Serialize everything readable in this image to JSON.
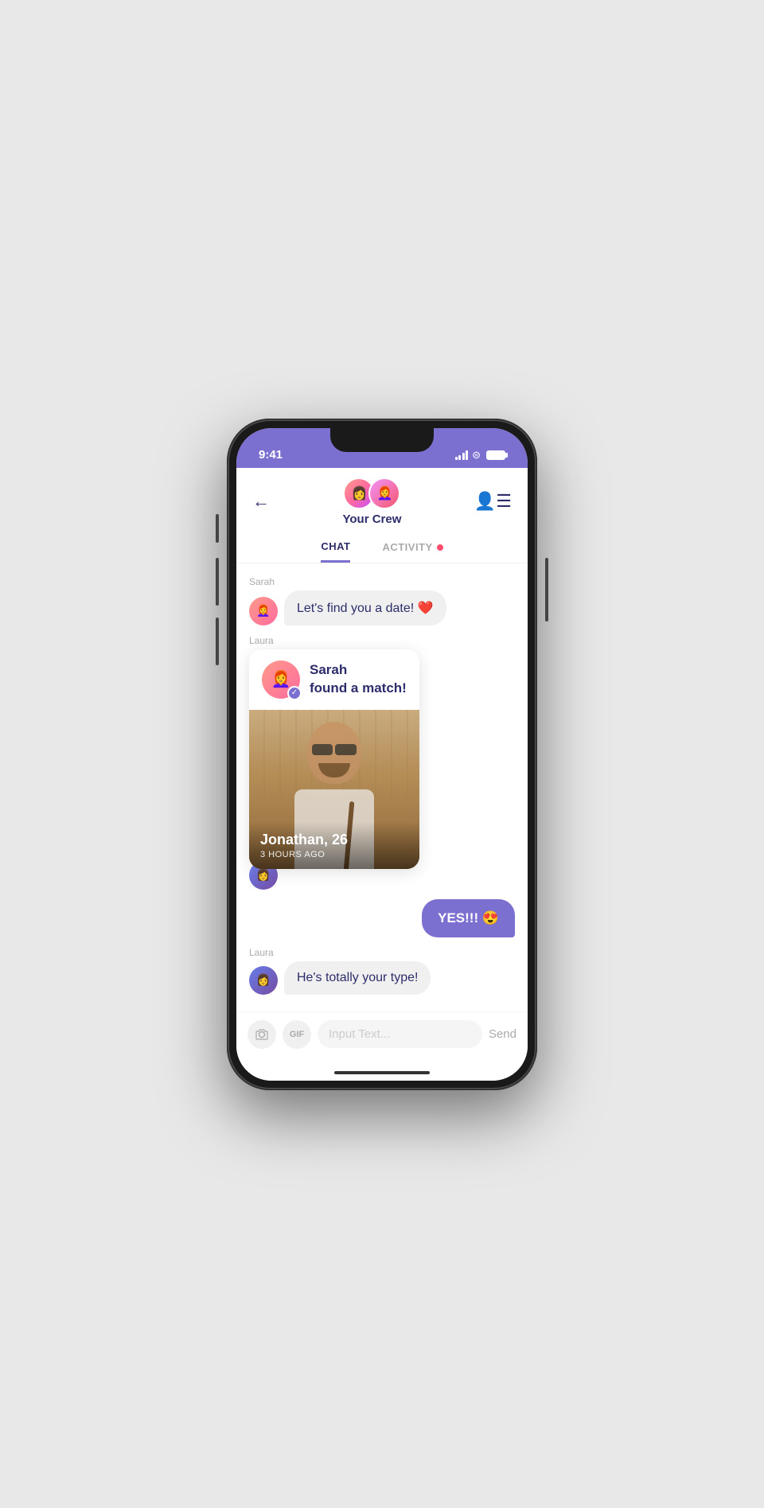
{
  "status_bar": {
    "time": "9:41",
    "signal": "signal-icon",
    "wifi": "wifi-icon",
    "battery": "battery-icon"
  },
  "header": {
    "back_label": "←",
    "crew_name": "Your Crew",
    "contacts_icon": "contacts-icon",
    "avatar1_emoji": "👩",
    "avatar2_emoji": "👩‍🦰"
  },
  "tabs": {
    "chat_label": "CHAT",
    "activity_label": "ACTIVITY"
  },
  "messages": [
    {
      "id": 1,
      "sender": "Sarah",
      "side": "left",
      "text": "Let's find you a date! ❤️",
      "avatar_emoji": "👩‍🦰"
    },
    {
      "id": 2,
      "sender": "Laura",
      "side": "left",
      "type": "match_card",
      "match_title": "Sarah\nfound a match!",
      "match_name": "Jonathan, 26",
      "match_time": "3 HOURS AGO",
      "avatar_emoji": "👩"
    },
    {
      "id": 3,
      "sender": "me",
      "side": "right",
      "text": "YES!!! 😍"
    },
    {
      "id": 4,
      "sender": "Laura",
      "side": "left",
      "text": "He's totally your type!",
      "avatar_emoji": "👩"
    }
  ],
  "input_area": {
    "camera_icon": "camera-icon",
    "gif_label": "GIF",
    "placeholder": "Input Text...",
    "send_label": "Send"
  },
  "colors": {
    "accent": "#7b6fd0",
    "dark_blue": "#2d2d6b",
    "bubble_left_bg": "#f0f0f0",
    "bubble_right_bg": "#7b6fd0",
    "activity_dot": "#ff4d6d"
  }
}
